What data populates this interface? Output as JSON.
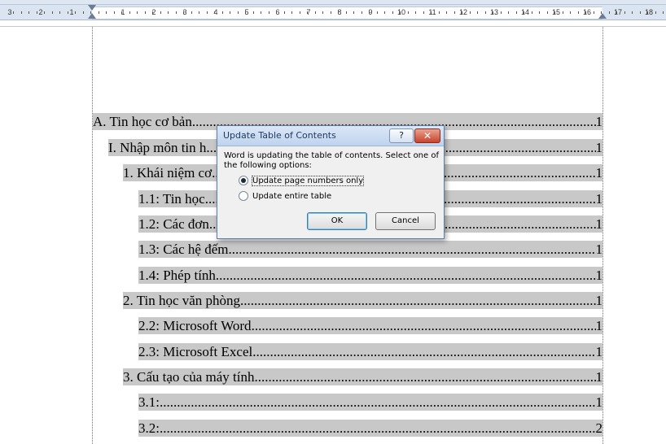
{
  "ruler": {
    "numbers_left": [
      "3",
      "2",
      "1"
    ],
    "numbers_right": [
      "1",
      "2",
      "3",
      "4",
      "5",
      "6",
      "7",
      "8",
      "9",
      "10",
      "11",
      "12",
      "13",
      "14",
      "15",
      "16",
      "17",
      "18"
    ]
  },
  "toc": [
    {
      "text": "A. Tin học cơ bản",
      "page": "1"
    },
    {
      "text": "I. Nhập môn tin h",
      "page": "1"
    },
    {
      "text": "1. Khái niệm cơ",
      "page": "1"
    },
    {
      "text": "1.1: Tin học",
      "page": "1"
    },
    {
      "text": "1.2: Các đơn",
      "page": "1"
    },
    {
      "text": "1.3: Các hệ đếm",
      "page": "1"
    },
    {
      "text": "1.4: Phép tính",
      "page": "1"
    },
    {
      "text": "2. Tin học văn phòng",
      "page": "1"
    },
    {
      "text": "2.2: Microsoft Word",
      "page": "1"
    },
    {
      "text": "2.3: Microsoft Excel",
      "page": "1"
    },
    {
      "text": "3. Cấu tạo của máy tính",
      "page": "1"
    },
    {
      "text": "3.1: ",
      "page": "1"
    },
    {
      "text": "3.2: ",
      "page": "2"
    }
  ],
  "dialog": {
    "title": "Update Table of Contents",
    "help_label": "?",
    "close_label": "✕",
    "message": "Word is updating the table of contents.  Select one of the following options:",
    "option1_label": "Update page numbers only",
    "option2_label": "Update entire table",
    "ok_label": "OK",
    "cancel_label": "Cancel"
  }
}
